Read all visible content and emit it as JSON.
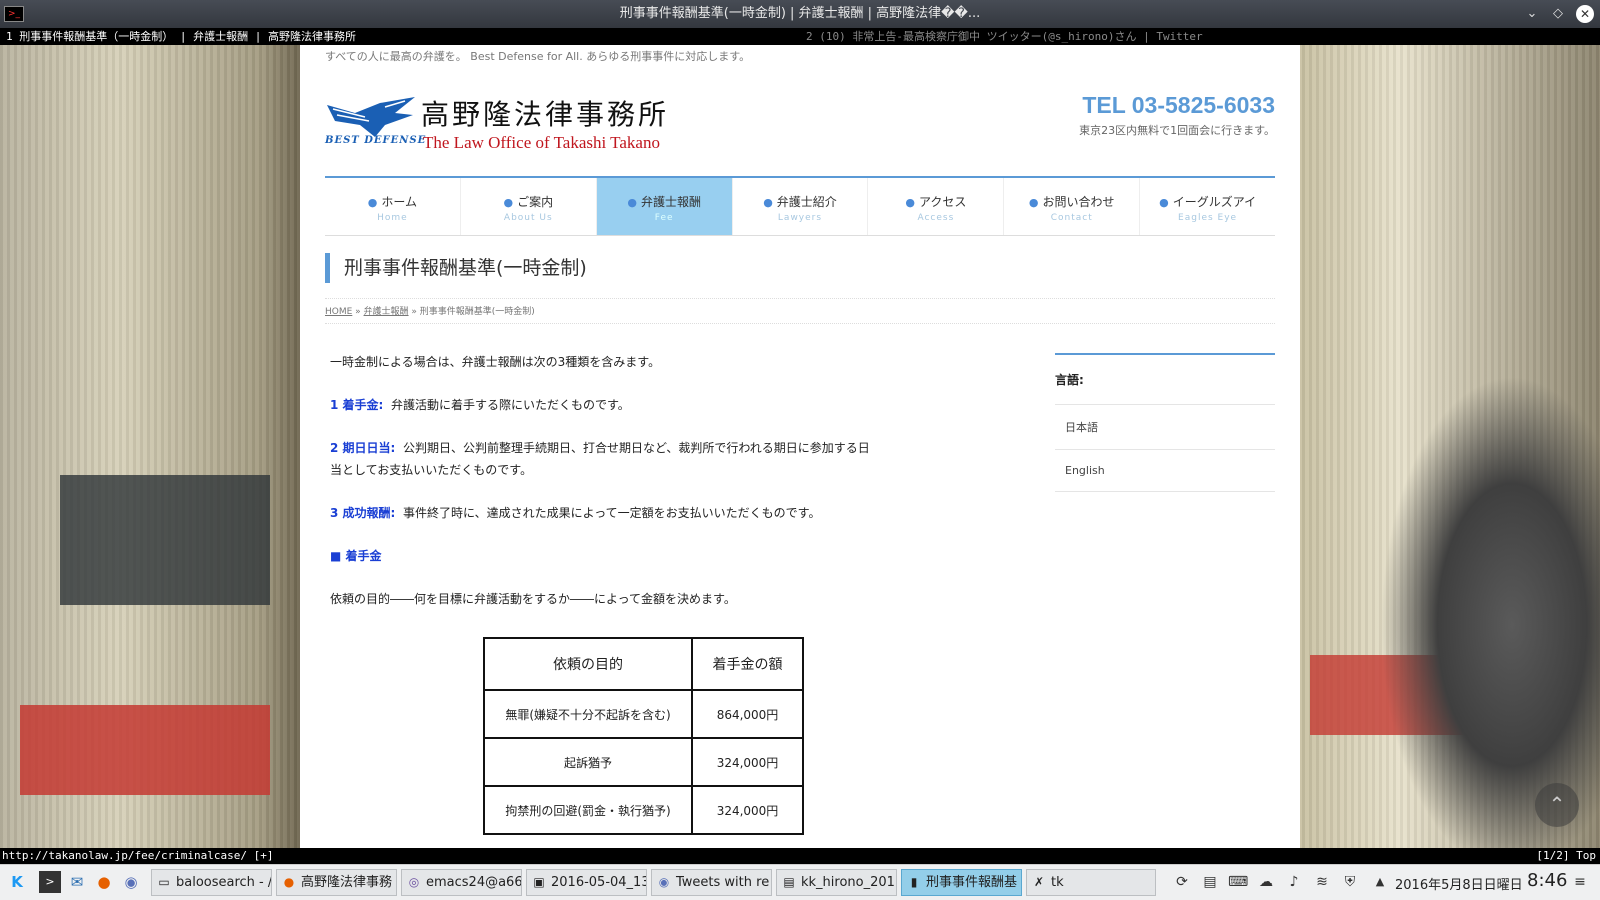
{
  "window": {
    "title": "刑事事件報酬基準(一時金制) | 弁護士報酬 | 高野隆法律��..."
  },
  "browser_tabs": [
    {
      "label": "1 刑事事件報酬基準（一時金制） | 弁護士報酬 | 高野隆法律事務所"
    },
    {
      "label": "2 (10) 非常上告-最高検察庁御中 ツイッター(@s_hirono)さん | Twitter"
    }
  ],
  "site": {
    "tagline": "すべての人に最高の弁護を。 Best Defense for All. あらゆる刑事事件に対応します。",
    "logo_badge": "BEST DEFENSE",
    "logo_jp": "高野隆法律事務所",
    "logo_en": "The Law Office of Takashi Takano",
    "tel": "TEL 03-5825-6033",
    "tel_note": "東京23区内無料で1回面会に行きます。",
    "nav": [
      {
        "label": "ホーム",
        "sub": "Home",
        "active": false
      },
      {
        "label": "ご案内",
        "sub": "About Us",
        "active": false
      },
      {
        "label": "弁護士報酬",
        "sub": "Fee",
        "active": true
      },
      {
        "label": "弁護士紹介",
        "sub": "Lawyers",
        "active": false
      },
      {
        "label": "アクセス",
        "sub": "Access",
        "active": false
      },
      {
        "label": "お問い合わせ",
        "sub": "Contact",
        "active": false
      },
      {
        "label": "イーグルズアイ",
        "sub": "Eagles Eye",
        "active": false
      }
    ]
  },
  "page": {
    "title": "刑事事件報酬基準(一時金制)",
    "breadcrumb": {
      "home": "HOME",
      "parent": "弁護士報酬",
      "current": "刑事事件報酬基準(一時金制)"
    },
    "intro": "一時金制による場合は、弁護士報酬は次の3種類を含みます。",
    "items": [
      {
        "head": "1 着手金:",
        "text": "弁護活動に着手する際にいただくものです。"
      },
      {
        "head": "2 期日日当:",
        "text": "公判期日、公判前整理手続期日、打合せ期日など、裁判所で行われる期日に参加する日",
        "text2": "当としてお支払いいただくものです。"
      },
      {
        "head": "3 成功報酬:",
        "text": "事件終了時に、達成された成果によって一定額をお支払いいただくものです。"
      }
    ],
    "section_heading": "■ 着手金",
    "section_text": "依頼の目的――何を目標に弁護活動をするか――によって金額を決めます。",
    "fee_table": {
      "headers": [
        "依頼の目的",
        "着手金の額"
      ],
      "rows": [
        [
          "無罪(嫌疑不十分不起訴を含む)",
          "864,000円"
        ],
        [
          "起訴猶予",
          "324,000円"
        ],
        [
          "拘禁刑の回避(罰金・執行猶予)",
          "324,000円"
        ]
      ]
    }
  },
  "sidebar": {
    "title": "言語:",
    "items": [
      "日本語",
      "English"
    ]
  },
  "status_bar": {
    "url": "http://takanolaw.jp/fee/criminalcase/ [+]",
    "position": "[1/2] Top"
  },
  "taskbar": {
    "tasks": [
      {
        "label": "baloosearch - /",
        "icon": "folder-icon"
      },
      {
        "label": "高野隆法律事務",
        "icon": "firefox-icon"
      },
      {
        "label": "emacs24@a66",
        "icon": "emacs-icon"
      },
      {
        "label": "2016-05-04_13",
        "icon": "image-icon"
      },
      {
        "label": "Tweets with re",
        "icon": "browser-icon"
      },
      {
        "label": "kk_hirono_201",
        "icon": "document-icon"
      },
      {
        "label": "刑事事件報酬基",
        "icon": "terminal-icon",
        "active": true
      },
      {
        "label": "tk",
        "icon": "x-icon"
      }
    ],
    "date": "2016年5月8日日曜日",
    "time": "8:46"
  }
}
